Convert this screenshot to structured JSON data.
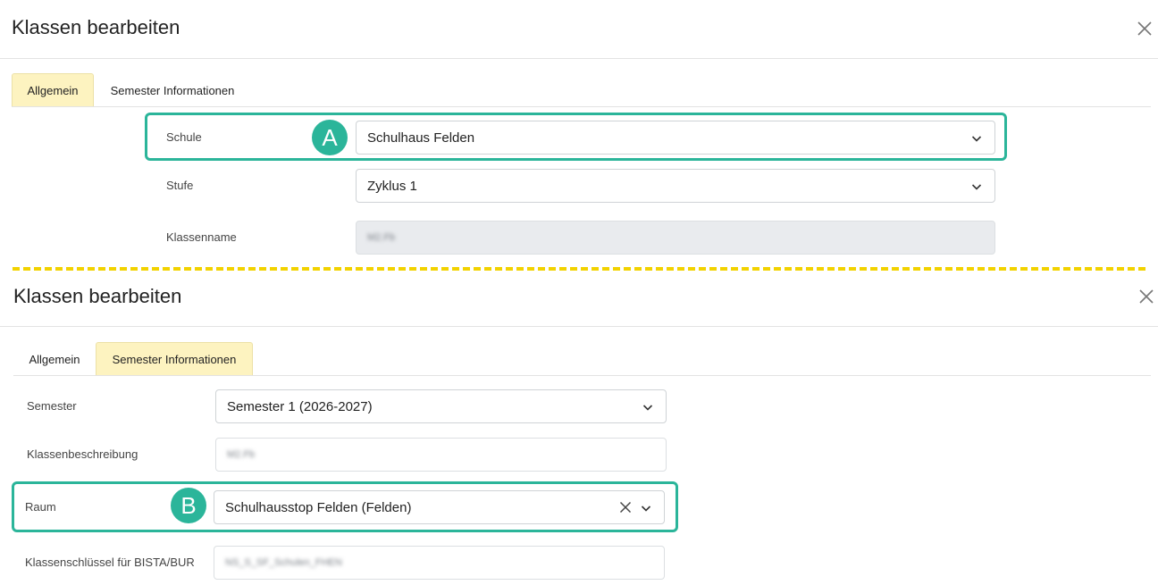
{
  "top": {
    "title": "Klassen bearbeiten",
    "tabs": [
      {
        "label": "Allgemein",
        "active": true
      },
      {
        "label": "Semester Informationen",
        "active": false
      }
    ],
    "fields": {
      "schule": {
        "label": "Schule",
        "value": "Schulhaus Felden"
      },
      "stufe": {
        "label": "Stufe",
        "value": "Zyklus 1"
      },
      "klassenname": {
        "label": "Klassenname",
        "value": "M2.Fb"
      }
    },
    "badge": "A"
  },
  "bottom": {
    "title": "Klassen bearbeiten",
    "tabs": [
      {
        "label": "Allgemein",
        "active": false
      },
      {
        "label": "Semester Informationen",
        "active": true
      }
    ],
    "fields": {
      "semester": {
        "label": "Semester",
        "value": "Semester 1 (2026-2027)"
      },
      "klassenbeschreibung": {
        "label": "Klassenbeschreibung",
        "value": "M2.Fb"
      },
      "raum": {
        "label": "Raum",
        "value": "Schulhausstop Felden (Felden)"
      },
      "klassenschluessel": {
        "label": "Klassenschlüssel für BISTA/BUR",
        "value": "NS_S_SF_Schulen_FHEN"
      }
    },
    "badge": "B"
  },
  "colors": {
    "accent": "#2bb59a",
    "active_tab": "#fdf3c0",
    "divider": "#f2d200"
  }
}
